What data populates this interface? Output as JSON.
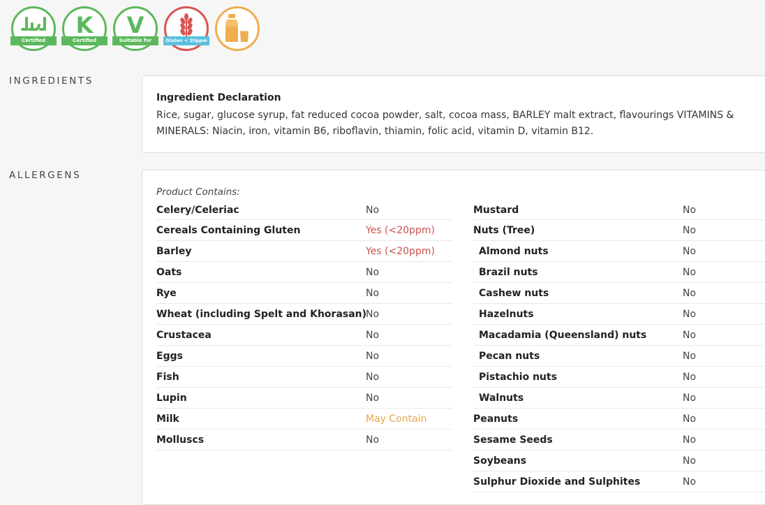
{
  "badges": [
    {
      "icon": "halal-icon",
      "ribbon": "Certified",
      "color": "#5cb85c"
    },
    {
      "icon": "kosher-icon",
      "ribbon": "Certified",
      "color": "#5cb85c",
      "glyph": "K"
    },
    {
      "icon": "vegetarian-icon",
      "ribbon": "Suitable for",
      "color": "#5cb85c",
      "glyph": "V"
    },
    {
      "icon": "wheat-icon",
      "ribbon": "Gluten < 20ppm",
      "color": "#d9534f"
    },
    {
      "icon": "milk-icon",
      "ribbon": "",
      "color": "#f0ad4e"
    }
  ],
  "ingredients": {
    "heading": "INGREDIENTS",
    "title": "Ingredient Declaration",
    "text": "Rice, sugar, glucose syrup, fat reduced cocoa powder, salt, cocoa mass, BARLEY malt extract, flavourings VITAMINS & MINERALS: Niacin, iron, vitamin B6, riboflavin, thiamin, folic acid, vitamin D, vitamin B12."
  },
  "allergens": {
    "heading": "ALLERGENS",
    "contains_label": "Product Contains:",
    "left": [
      {
        "name": "Celery/Celeriac",
        "value": "No"
      },
      {
        "name": "Cereals Containing Gluten",
        "value": "Yes (<20ppm)"
      },
      {
        "name": "Barley",
        "value": "Yes (<20ppm)"
      },
      {
        "name": "Oats",
        "value": "No"
      },
      {
        "name": "Rye",
        "value": "No"
      },
      {
        "name": "Wheat (including Spelt and Khorasan)",
        "value": "No"
      },
      {
        "name": "Crustacea",
        "value": "No"
      },
      {
        "name": "Eggs",
        "value": "No"
      },
      {
        "name": "Fish",
        "value": "No"
      },
      {
        "name": "Lupin",
        "value": "No"
      },
      {
        "name": "Milk",
        "value": "May Contain"
      },
      {
        "name": "Molluscs",
        "value": "No"
      }
    ],
    "right": [
      {
        "name": "Mustard",
        "value": "No"
      },
      {
        "name": "Nuts (Tree)",
        "value": "No"
      },
      {
        "name": "Almond nuts",
        "value": "No"
      },
      {
        "name": "Brazil nuts",
        "value": "No"
      },
      {
        "name": "Cashew nuts",
        "value": "No"
      },
      {
        "name": "Hazelnuts",
        "value": "No"
      },
      {
        "name": "Macadamia (Queensland) nuts",
        "value": "No"
      },
      {
        "name": "Pecan nuts",
        "value": "No"
      },
      {
        "name": "Pistachio nuts",
        "value": "No"
      },
      {
        "name": "Walnuts",
        "value": "No"
      },
      {
        "name": "Peanuts",
        "value": "No"
      },
      {
        "name": "Sesame Seeds",
        "value": "No"
      },
      {
        "name": "Soybeans",
        "value": "No"
      },
      {
        "name": "Sulphur Dioxide and Sulphites",
        "value": "No"
      }
    ],
    "colors": {
      "yes": "#c9534e",
      "may_contain": "#e8a64b",
      "no": "#444444"
    }
  }
}
